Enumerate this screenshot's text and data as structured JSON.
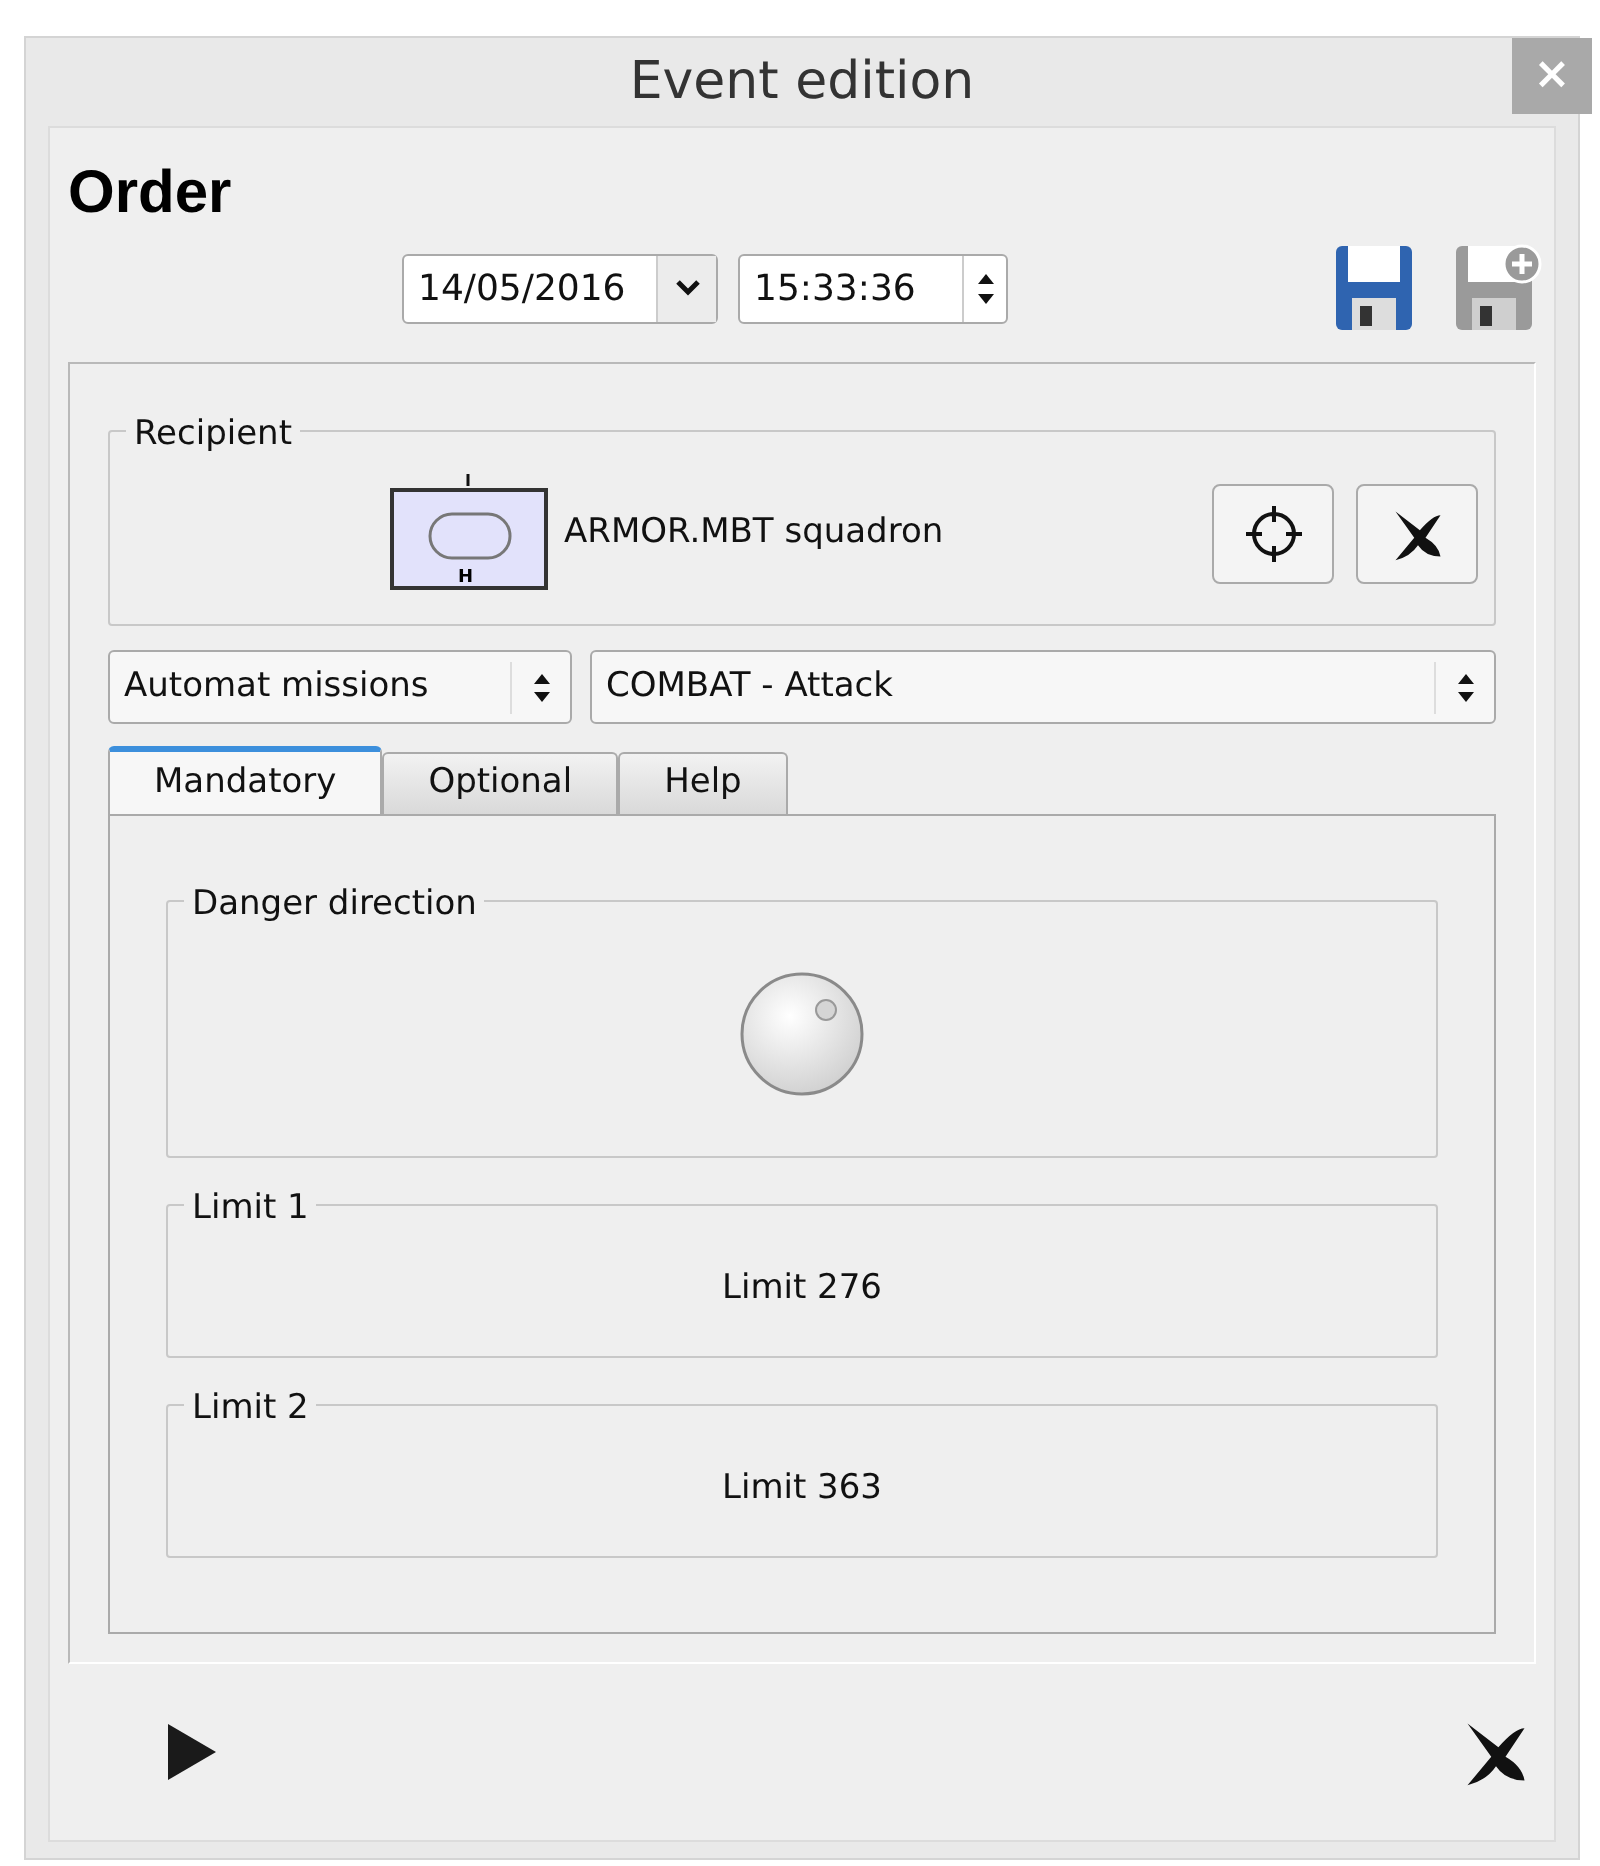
{
  "window": {
    "title": "Event edition",
    "close": "×"
  },
  "heading": "Order",
  "date": {
    "value": "14/05/2016"
  },
  "time": {
    "value": "15:33:36"
  },
  "recipient": {
    "label": "Recipient",
    "unit": "ARMOR.MBT squadron",
    "symbol_bottom": "H"
  },
  "combos": [
    {
      "value": "Automat missions"
    },
    {
      "value": "COMBAT - Attack"
    }
  ],
  "tabs": [
    {
      "label": "Mandatory",
      "selected": true
    },
    {
      "label": "Optional",
      "selected": false
    },
    {
      "label": "Help",
      "selected": false
    }
  ],
  "groups": [
    {
      "kind": "knob",
      "label": "Danger direction"
    },
    {
      "kind": "value",
      "label": "Limit 1",
      "value": "Limit 276"
    },
    {
      "kind": "value",
      "label": "Limit 2",
      "value": "Limit 363"
    }
  ]
}
